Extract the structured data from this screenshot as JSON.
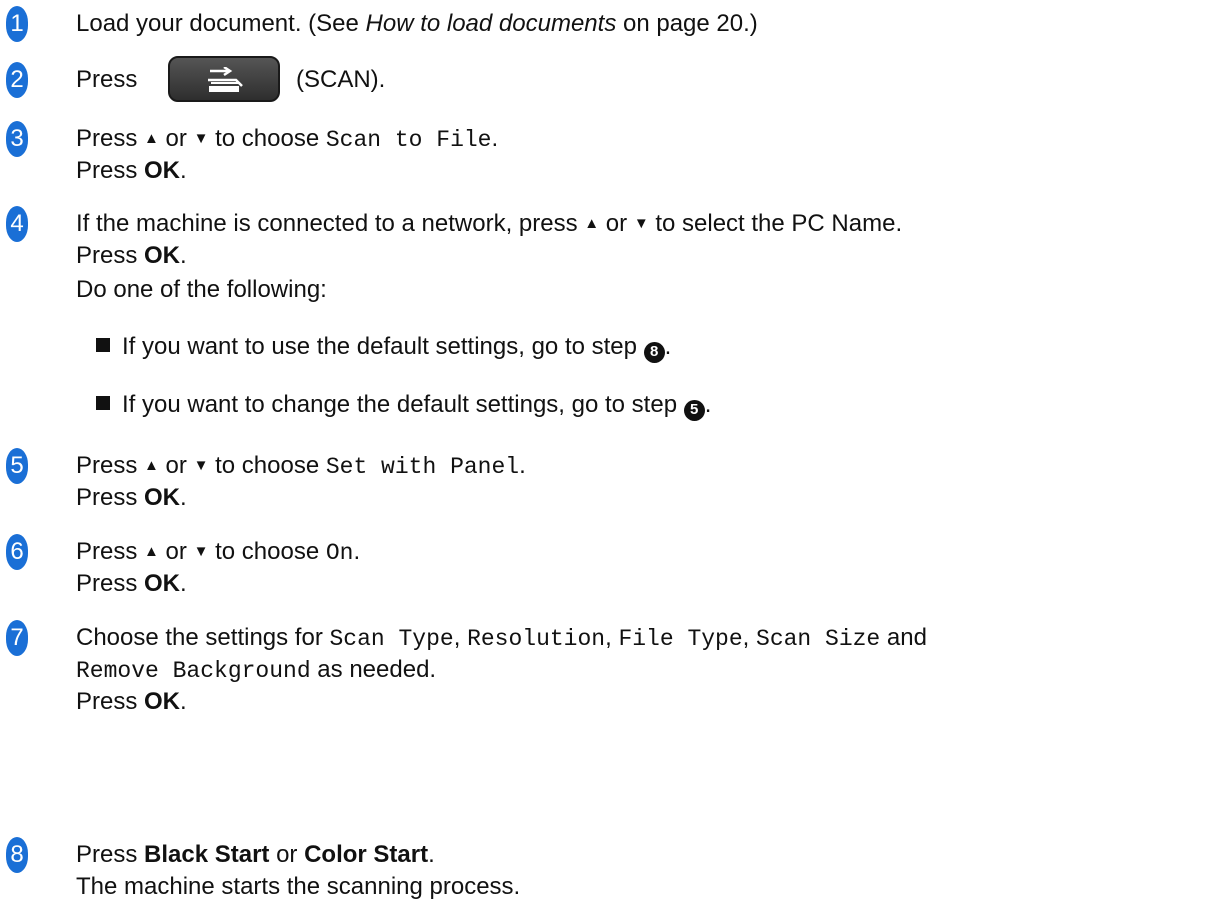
{
  "steps": [
    {
      "n": "1",
      "pre": "Load your document. (See ",
      "ref": "How to load documents",
      "post": " on page 20.)"
    },
    {
      "n": "2",
      "press": "Press",
      "after": "(SCAN)."
    },
    {
      "n": "3",
      "pre": "Press ",
      "up": "▲",
      "or": " or ",
      "down": "▼",
      "to": " to choose ",
      "code": "Scan to File",
      "end": ".",
      "press": "Press ",
      "ok": "OK",
      "dot": "."
    },
    {
      "n": "4",
      "text": "If the machine is connected to a network, press ",
      "up": "▲",
      "or": " or ",
      "down": "▼",
      "to": " to select the PC Name.",
      "press": "Press ",
      "ok": "OK",
      "dot": ".",
      "do": "Do one of the following:",
      "bullets": [
        {
          "text": "If you want to use the default settings, go to step ",
          "ref": "8",
          "end": "."
        },
        {
          "text": "If you want to change the default settings, go to step ",
          "ref": "5",
          "end": "."
        }
      ]
    },
    {
      "n": "5",
      "pre": "Press ",
      "up": "▲",
      "or": " or ",
      "down": "▼",
      "to": " to choose ",
      "code": "Set with Panel",
      "end": ".",
      "press": "Press ",
      "ok": "OK",
      "dot": "."
    },
    {
      "n": "6",
      "pre": "Press ",
      "up": "▲",
      "or": " or ",
      "down": "▼",
      "to": " to choose ",
      "code": "On",
      "end": ".",
      "press": "Press ",
      "ok": "OK",
      "dot": "."
    },
    {
      "n": "7",
      "pre": "Choose the settings for ",
      "c1": "Scan Type",
      "s1": ", ",
      "c2": "Resolution",
      "s2": ", ",
      "c3": "File Type",
      "s3": ", ",
      "c4": "Scan Size",
      "and": " and",
      "c5": "Remove Background",
      "asneeded": " as needed.",
      "press": "Press ",
      "ok": "OK",
      "dot": "."
    },
    {
      "n": "8",
      "pre": "Press ",
      "b1": "Black Start",
      "or": " or ",
      "b2": "Color Start",
      "dot": ".",
      "line2": "The machine starts the scanning process."
    }
  ],
  "colors": {
    "step_badge": "#1a6fd6",
    "scan_button": "#3a3a3a"
  },
  "icons": {
    "scan_button": "scan-icon"
  }
}
